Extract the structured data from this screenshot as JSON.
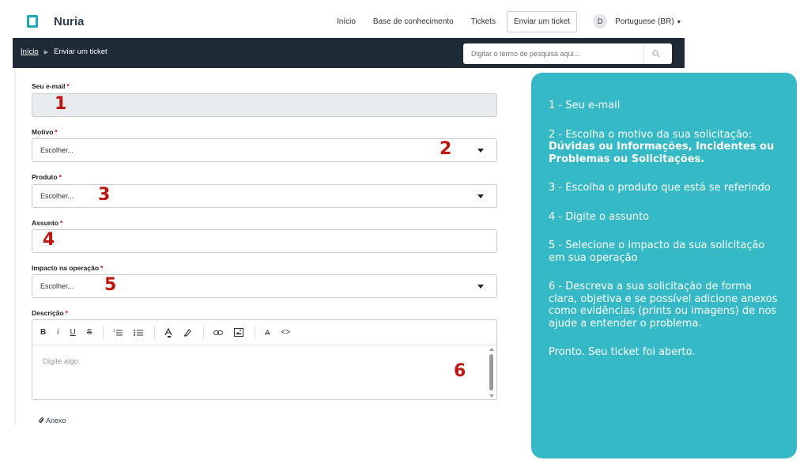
{
  "nav": {
    "brand": "Nuria",
    "links": [
      "Início",
      "Base de conhecimento",
      "Tickets"
    ],
    "active_button": "Enviar um ticket",
    "avatar_initial": "D",
    "language": "Portuguese (BR)"
  },
  "breadcrumb": {
    "home": "Início",
    "current": "Enviar um ticket"
  },
  "search": {
    "placeholder": "Digitar o termo de pesquisa aqui..."
  },
  "form": {
    "email_label": "Seu e-mail",
    "reason_label": "Motivo",
    "reason_value": "Escolher...",
    "product_label": "Produto",
    "product_value": "Escolher...",
    "subject_label": "Assunto",
    "impact_label": "Impacto na operação",
    "impact_value": "Escolher...",
    "description_label": "Descrição",
    "description_placeholder": "Digite algo",
    "required_mark": "*",
    "attachment_label": "Anexo"
  },
  "editor_toolbar": {
    "bold": "B",
    "italic": "i",
    "underline": "U",
    "strike": "S",
    "clear": "A",
    "code": "<>"
  },
  "step_numbers": [
    "1",
    "2",
    "3",
    "4",
    "5",
    "6"
  ],
  "instructions": {
    "s1": "1 - Seu e-mail",
    "s2_prefix": "2 - Escolha o motivo da sua solicitação: ",
    "s2_bold": "Dúvidas ou Informações, Incidentes ou Problemas ou Solicitações.",
    "s3": "3 - Escolha o produto que está se referindo",
    "s4": "4 - Digite o assunto",
    "s5": "5 - Selecione o impacto da sua solicitação em sua operação",
    "s6": "6 - Descreva a sua solicitação de forma clara, objetiva e se possível adicione anexos como evidências (prints ou imagens) de nos ajude a entender o problema.",
    "s7": "Pronto. Seu ticket foi aberto."
  },
  "colors": {
    "brand": "#1ea9b4",
    "dark_bar": "#1f2a37",
    "card": "#36b9c7",
    "step_number": "#c0150e",
    "required": "#d0021b"
  }
}
